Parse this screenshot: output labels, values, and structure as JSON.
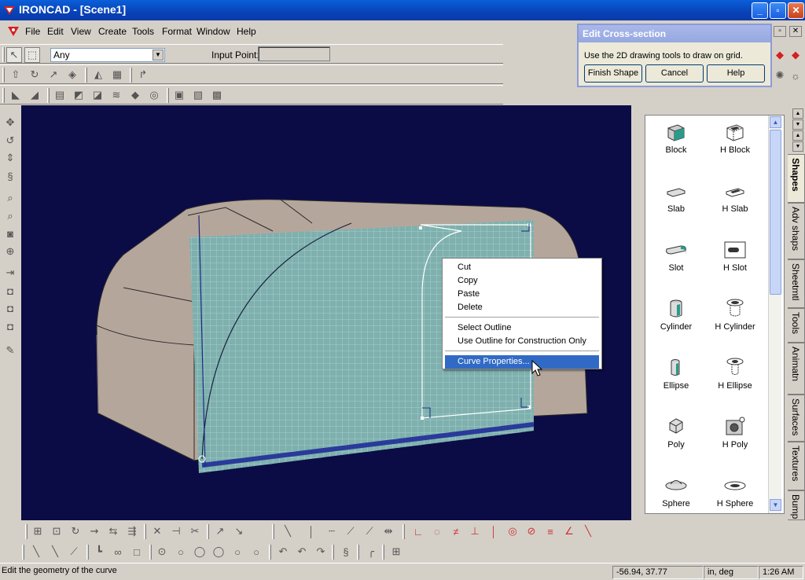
{
  "window": {
    "title": "IRONCAD - [Scene1]",
    "min": "_",
    "max": "▫",
    "close": "✕"
  },
  "menu": [
    "File",
    "Edit",
    "View",
    "Create",
    "Tools",
    "Format",
    "Window",
    "Help"
  ],
  "toolbar": {
    "filter_value": "Any",
    "input_point_label": "Input Point:"
  },
  "dialog": {
    "title": "Edit Cross-section",
    "message": "Use the 2D drawing tools to draw on grid.",
    "buttons": [
      "Finish Shape",
      "Cancel",
      "Help"
    ]
  },
  "context_menu": {
    "items": [
      "Cut",
      "Copy",
      "Paste",
      "Delete",
      "Select Outline",
      "Use Outline for Construction Only",
      "Curve Properties..."
    ],
    "selected": "Curve Properties..."
  },
  "catalog": {
    "shapes": [
      [
        "Block",
        "H Block"
      ],
      [
        "Slab",
        "H Slab"
      ],
      [
        "Slot",
        "H Slot"
      ],
      [
        "Cylinder",
        "H Cylinder"
      ],
      [
        "Ellipse",
        "H Ellipse"
      ],
      [
        "Poly",
        "H Poly"
      ],
      [
        "Sphere",
        "H Sphere"
      ]
    ],
    "tabs": [
      "Shapes",
      "Adv shaps",
      "Sheetmtl",
      "Tools",
      "Animatn",
      "Surfaces",
      "Textures",
      "Bump"
    ],
    "active_tab": "Shapes"
  },
  "status": {
    "message": "Edit the geometry of the curve",
    "coords": "-56.94, 37.77",
    "units": "in, deg",
    "time": "1:26 AM"
  },
  "colors": {
    "title_bar": "#0842b8",
    "viewport_bg": "#0b0c45",
    "selection": "#316ac5",
    "model": "#b5a69b",
    "grid": "#7fb0ae"
  }
}
